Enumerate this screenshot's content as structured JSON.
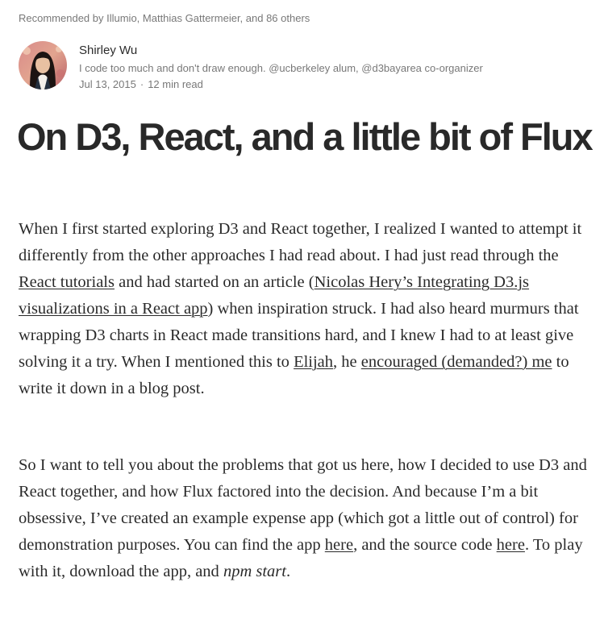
{
  "recommended": {
    "text": "Recommended by Illumio, Matthias Gattermeier, and 86 others"
  },
  "author": {
    "name": "Shirley Wu",
    "bio": "I code too much and don't draw enough. @ucberkeley alum, @d3bayarea co-organizer",
    "date": "Jul 13, 2015",
    "separator": "·",
    "read_time": "12 min read"
  },
  "article": {
    "title": "On D3, React, and a little bit of Flux",
    "para1": {
      "t1": "When I first started exploring D3 and React together, I realized I wanted to attempt it differently from the other approaches I had read about. I had just read through the ",
      "link1": "React tutorials",
      "t2": " and had started on an article (",
      "link2": "Nicolas Hery’s Integrating D3.js visualizations in a React app",
      "t3": ") when inspiration struck. I had also heard murmurs that wrapping D3 charts in React made transitions hard, and I knew I had to at least give solving it a try. When I mentioned this to ",
      "link3": "Elijah",
      "t4": ", he ",
      "link4": "encouraged (demanded?) me",
      "t5": " to write it down in a blog post."
    },
    "para2": {
      "t1": "So I want to tell you about the problems that got us here, how I decided to use D3 and React together, and how Flux factored into the decision. And because I’m a bit obsessive, I’ve created an example expense app (which got a little out of control) for demonstration purposes. You can find the app ",
      "link1": "here",
      "t2": ", and the source code ",
      "link2": "here",
      "t3": ". To play with it, download the app, and ",
      "em1": "npm start",
      "t4": "."
    }
  },
  "colors": {
    "text": "#1f1f1f",
    "muted": "#8a8a8a",
    "background": "#ffffff"
  }
}
